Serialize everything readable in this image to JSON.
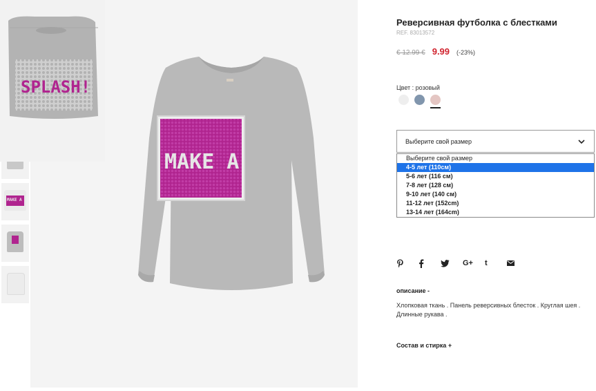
{
  "product": {
    "title": "Реверсивная футболка с блестками",
    "ref": "REF. 83013572",
    "old_price": "€ 12.99 €",
    "new_price": "9.99",
    "discount": "(-23%)"
  },
  "color": {
    "label": "Цвет : розовый",
    "swatches": [
      {
        "name": "white",
        "hex": "#eeeeee"
      },
      {
        "name": "grey-blue",
        "hex": "#8196ad"
      },
      {
        "name": "pink",
        "hex": "#e4c6c3"
      }
    ],
    "selected_index": 2
  },
  "size": {
    "placeholder": "Выберите свой размер",
    "options": [
      "Выберите свой размер",
      "4-5 лет (110см)",
      "5-6 лет (116 см)",
      "7-8 лет (128 см)",
      "9-10 лет (140 см)",
      "11-12 лет (152cm)",
      "13-14 лет (164cm)"
    ],
    "highlighted_index": 1
  },
  "share": {
    "icons": [
      "pinterest-icon",
      "facebook-icon",
      "twitter-icon",
      "google-plus-icon",
      "tumblr-icon",
      "email-icon"
    ],
    "glyphs": [
      "P",
      "f",
      "",
      "G+",
      "t",
      ""
    ]
  },
  "description": {
    "heading": "описание -",
    "text": "Хлопковая ткань . Панель реверсивных блесток . Круглая шея . Длинные рукава ."
  },
  "composition": {
    "heading": "Состав и стирка +"
  },
  "images": {
    "inset_text": "SPLASH!",
    "main_text": "MAKE A",
    "thumb_text": "MAKE A"
  },
  "colors": {
    "accent_red": "#d0242f",
    "highlight_blue": "#1e73e8",
    "sequin_magenta": "#b0248f",
    "shirt_grey": "#b9b9b9"
  }
}
